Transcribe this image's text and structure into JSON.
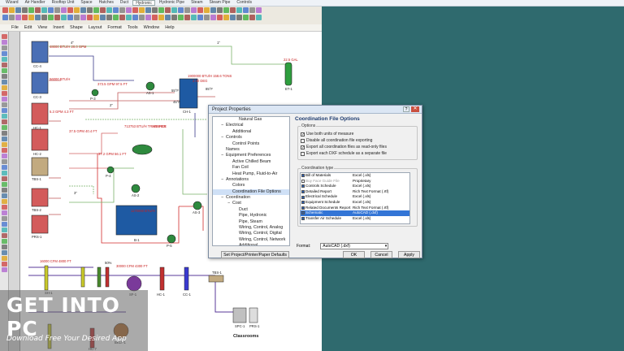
{
  "app": {
    "ribbon_tabs": [
      "Wizard",
      "Air Handler",
      "Rooftop Unit",
      "Space",
      "Hatches",
      "Duct",
      "Hydronic",
      "Hydronic Pipe",
      "Steam",
      "Steam Pipe",
      "Controls"
    ],
    "active_ribbon_tab": "Hydronic",
    "menu": [
      "File",
      "Edit",
      "View",
      "Insert",
      "Shape",
      "Layout",
      "Format",
      "Tools",
      "Window",
      "Help"
    ]
  },
  "drawing": {
    "labels": {
      "cc4": "CC-4",
      "cc3": "CC-3",
      "hc1": "HC-1",
      "hc2": "HC-2",
      "tbs1": "TBS-1",
      "tbs2": "TBS-2",
      "prs1": "PRS-1",
      "ch1": "CH-1",
      "et1": "ET-1",
      "p3": "P-3",
      "p4": "P-4",
      "as1": "AS-1",
      "p5": "P-5",
      "as3": "AS-3",
      "b1": "B-1",
      "as2": "AS-2",
      "et1_cap": "22.5 GAL",
      "ch1_cap": "1900000 BTU/H\n158.6 TONS",
      "ch1_cap2": "2.00 DEG",
      "transfer": "713753 BTU/H\nTRANSFER",
      "source": "SOURCE",
      "flow1": "373.5 GPM\n97.5 FT",
      "flow2": "37.2 GPM\n56.1 FT",
      "btuh1": "48000 BTU/H\n20.0 GPM",
      "btuh2": "56000 BTU/H",
      "btuh3": "37.5 GPM\n40.4 FT",
      "btuh4": "5.3 GPM\n4.3 FT",
      "b1_cap": "1170000 BTU/H",
      "pipe_size1": "4\"",
      "pipe_size2": "2\"",
      "pipe_size3": "3\"",
      "pipe_size4": "1\"",
      "ahu_cfm1": "16000 CFM\n4800 FT",
      "ahu_cfm2": "30000 CFM\n4300 FT",
      "fan": "SF-1",
      "hc": "HC-1",
      "cc": "CC-1",
      "tbs": "TBS-1",
      "pct": "50%",
      "sh1": "SH-1",
      "hc7": "HC-7",
      "vav": "BKLT-1",
      "spc": "SPC-1",
      "prs": "PRS-1",
      "temp_a": "55°F",
      "temp_b": "45°F",
      "temp_c": "85°F",
      "classrooms": "Classrooms"
    }
  },
  "dialog": {
    "title": "Project Properties",
    "help": "?",
    "close": "✕",
    "tree": [
      {
        "label": "Natural Gas",
        "indent": 3,
        "sign": ""
      },
      {
        "label": "Electrical",
        "indent": 1,
        "sign": "−"
      },
      {
        "label": "Additional",
        "indent": 2,
        "sign": ""
      },
      {
        "label": "Controls",
        "indent": 1,
        "sign": "−"
      },
      {
        "label": "Control Points",
        "indent": 2,
        "sign": ""
      },
      {
        "label": "Names",
        "indent": 1,
        "sign": ""
      },
      {
        "label": "Equipment Preferences",
        "indent": 1,
        "sign": "−"
      },
      {
        "label": "Active Chilled Beam",
        "indent": 2,
        "sign": ""
      },
      {
        "label": "Fan Coil",
        "indent": 2,
        "sign": ""
      },
      {
        "label": "Heat Pump, Fluid-to-Air",
        "indent": 2,
        "sign": ""
      },
      {
        "label": "Annotations",
        "indent": 1,
        "sign": "−"
      },
      {
        "label": "Colors",
        "indent": 2,
        "sign": ""
      },
      {
        "label": "Coordination File Options",
        "indent": 2,
        "sign": "",
        "selected": true
      },
      {
        "label": "Coordination",
        "indent": 1,
        "sign": "−"
      },
      {
        "label": "Cost",
        "indent": 2,
        "sign": "−"
      },
      {
        "label": "Duct",
        "indent": 3,
        "sign": ""
      },
      {
        "label": "Pipe, Hydronic",
        "indent": 3,
        "sign": ""
      },
      {
        "label": "Pipe, Steam",
        "indent": 3,
        "sign": ""
      },
      {
        "label": "Wiring, Control, Analog",
        "indent": 3,
        "sign": ""
      },
      {
        "label": "Wiring, Control, Digital",
        "indent": 3,
        "sign": ""
      },
      {
        "label": "Wiring, Control, Network",
        "indent": 3,
        "sign": ""
      },
      {
        "label": "Additional",
        "indent": 3,
        "sign": ""
      }
    ],
    "heading": "Coordination File Options",
    "options_label": "Options",
    "options": [
      {
        "label": "Use both units of measure",
        "checked": true
      },
      {
        "label": "Disable all coordination file exporting",
        "checked": false
      },
      {
        "label": "Export all coordination files as read-only files",
        "checked": true
      },
      {
        "label": "Export each DXF schedule as a separate file",
        "checked": false
      }
    ],
    "types_label": "Coordination type",
    "types": [
      {
        "name": "Bill of Materials",
        "format": "Excel (.xls)",
        "checked": true
      },
      {
        "name": "Buy Face Guide File",
        "format": "Proprietary",
        "checked": false,
        "dim": true
      },
      {
        "name": "Controls Schedule",
        "format": "Excel (.xls)",
        "checked": true
      },
      {
        "name": "Detailed Report",
        "format": "Rich Text Format (.rtf)",
        "checked": true
      },
      {
        "name": "Electrical Schedule",
        "format": "Excel (.xls)",
        "checked": true
      },
      {
        "name": "Equipment Schedule",
        "format": "Excel (.xls)",
        "checked": true
      },
      {
        "name": "Related Documents Report",
        "format": "Rich Text Format (.rtf)",
        "checked": true
      },
      {
        "name": "Schematic",
        "format": "AutoCAD (.dxf)",
        "checked": true,
        "selected": true
      },
      {
        "name": "Transfer Air Schedule",
        "format": "Excel (.xls)",
        "checked": true
      }
    ],
    "format_label": "Format:",
    "format_value": "AutoCAD (.dxf)",
    "set_defaults": "Set Project/Printer/Paper Defaults",
    "ok": "OK",
    "cancel": "Cancel",
    "apply": "Apply"
  },
  "watermark": {
    "logo": "GET INTO PC",
    "tagline": "Download Free Your Desired App"
  }
}
